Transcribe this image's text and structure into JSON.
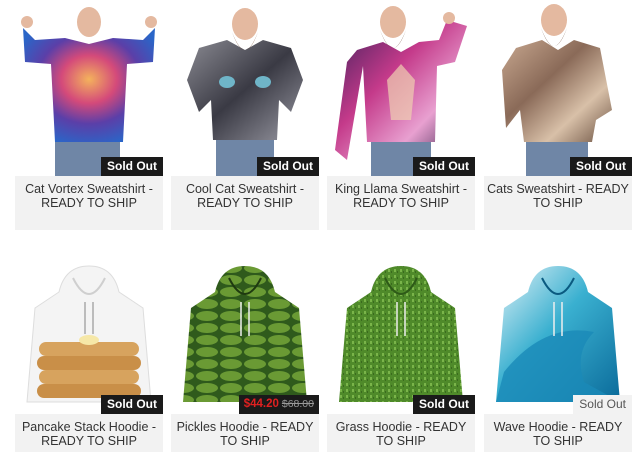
{
  "products": [
    {
      "title": "Cat Vortex Sweatshirt - READY TO SHIP",
      "badge": "Sold Out"
    },
    {
      "title": "Cool Cat Sweatshirt - READY TO SHIP",
      "badge": "Sold Out"
    },
    {
      "title": "King Llama Sweatshirt - READY TO SHIP",
      "badge": "Sold Out"
    },
    {
      "title": "Cats Sweatshirt - READY TO SHIP",
      "badge": "Sold Out"
    },
    {
      "title": "Pancake Stack Hoodie - READY TO SHIP",
      "badge": "Sold Out"
    },
    {
      "title": "Pickles Hoodie - READY TO SHIP",
      "sale_price": "$44.20",
      "original_price": "$68.00"
    },
    {
      "title": "Grass Hoodie - READY TO SHIP",
      "badge": "Sold Out"
    },
    {
      "title": "Wave Hoodie - READY TO SHIP",
      "badge": "Sold Out"
    }
  ],
  "colors": {
    "badge_bg": "#1a1a1a",
    "caption_bg": "#f2f2f2",
    "sale_red": "#e02020"
  }
}
